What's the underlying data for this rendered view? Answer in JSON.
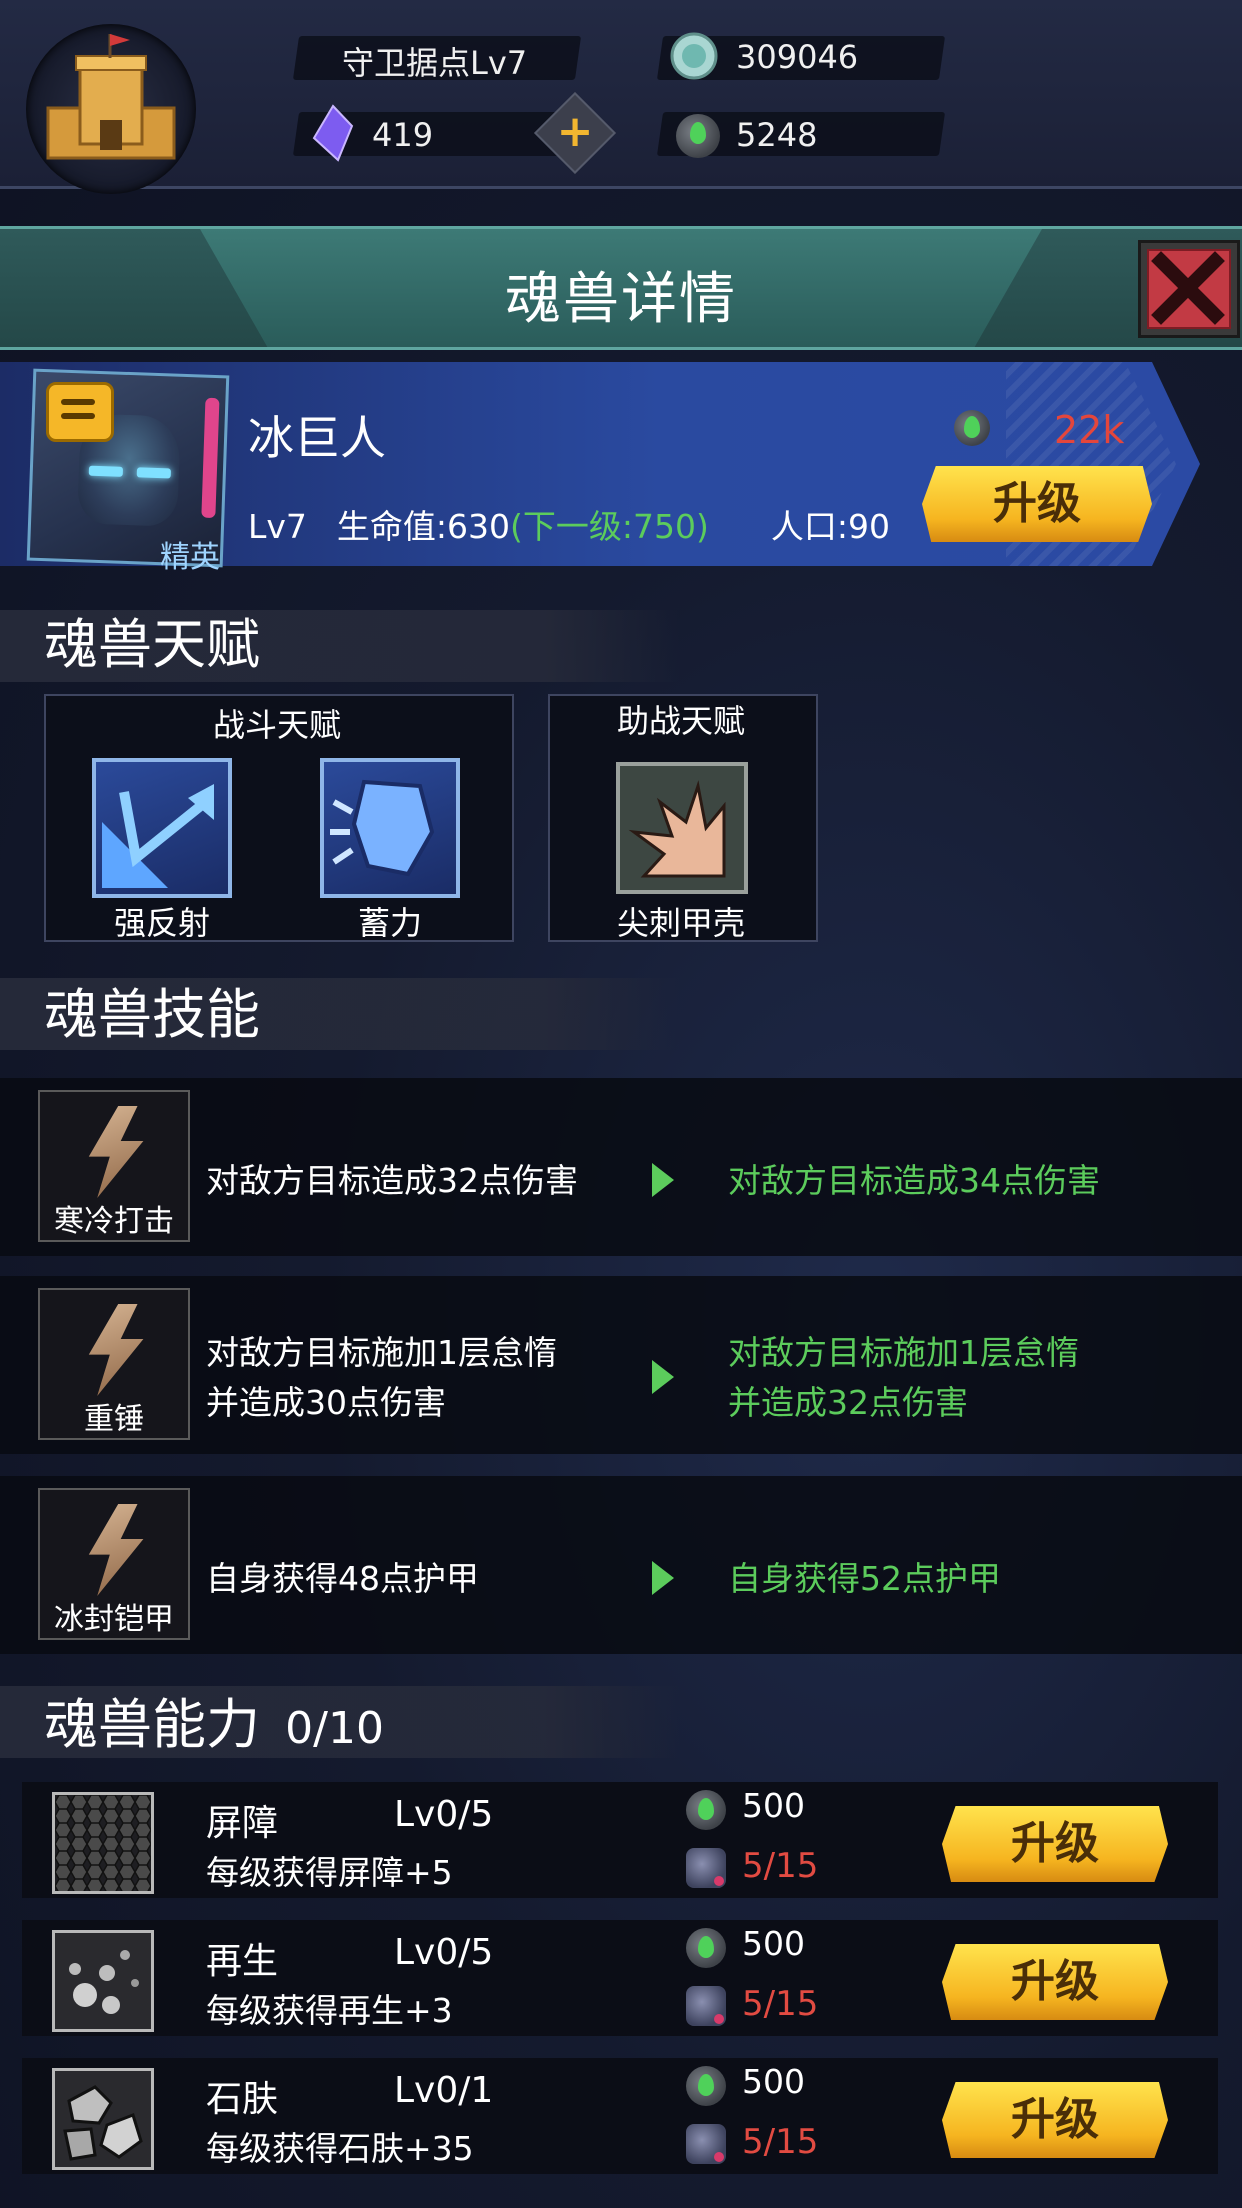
{
  "topbar": {
    "fort_level": "守卫据点Lv7",
    "coins": "309046",
    "crystals": "419",
    "soulstone": "5248"
  },
  "header": {
    "title": "魂兽详情"
  },
  "monster": {
    "rank": "精英",
    "name": "冰巨人",
    "level": "Lv7",
    "hp": "生命值:630",
    "hp_next": "(下一级:750)",
    "population": "人口:90",
    "upgrade_cost": "22k",
    "upgrade_label": "升级"
  },
  "talents": {
    "section_title": "魂兽天赋",
    "combat": {
      "title": "战斗天赋",
      "items": [
        {
          "label": "强反射",
          "icon": "reflect-arrow-icon"
        },
        {
          "label": "蓄力",
          "icon": "fist-icon"
        }
      ]
    },
    "support": {
      "title": "助战天赋",
      "items": [
        {
          "label": "尖刺甲壳",
          "icon": "spike-shell-icon"
        }
      ]
    }
  },
  "skills": {
    "section_title": "魂兽技能",
    "items": [
      {
        "name": "寒冷打击",
        "current": [
          "对敌方目标造成32点伤害"
        ],
        "next": [
          "对敌方目标造成34点伤害"
        ]
      },
      {
        "name": "重锤",
        "current": [
          "对敌方目标施加1层怠惰",
          "并造成30点伤害"
        ],
        "next": [
          "对敌方目标施加1层怠惰",
          "并造成32点伤害"
        ]
      },
      {
        "name": "冰封铠甲",
        "current": [
          "自身获得48点护甲"
        ],
        "next": [
          "自身获得52点护甲"
        ]
      }
    ]
  },
  "abilities": {
    "section_title": "魂兽能力",
    "progress": "0/10",
    "items": [
      {
        "name": "屏障",
        "level": "Lv0/5",
        "desc": "每级获得屏障+5",
        "cost": "500",
        "fragments": "5/15",
        "button": "升级",
        "icon": "hex-barrier-icon"
      },
      {
        "name": "再生",
        "level": "Lv0/5",
        "desc": "每级获得再生+3",
        "cost": "500",
        "fragments": "5/15",
        "button": "升级",
        "icon": "regen-dots-icon"
      },
      {
        "name": "石肤",
        "level": "Lv0/1",
        "desc": "每级获得石肤+35",
        "cost": "500",
        "fragments": "5/15",
        "button": "升级",
        "icon": "stone-skin-icon"
      }
    ]
  },
  "colors": {
    "green": "#5ccc5c",
    "red": "#e24b42",
    "gold": "#f6b520",
    "teal": "#3d7a76"
  }
}
